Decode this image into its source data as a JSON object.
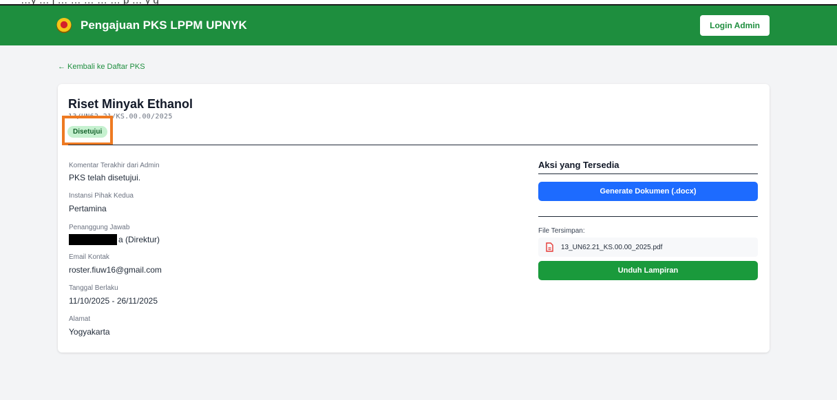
{
  "top_cut_text": "…y  …  j   …  …          …   …           …  p       …  y  g",
  "navbar": {
    "brand": "Pengajuan PKS LPPM UPNYK",
    "login_label": "Login Admin"
  },
  "back_link": "← Kembali ke Daftar PKS",
  "pks": {
    "title": "Riset Minyak Ethanol",
    "number": "13/UN62.21/KS.00.00/2025",
    "status": "Disetujui",
    "status_color": "#c6f1d0"
  },
  "fields": [
    {
      "label": "Komentar Terakhir dari Admin",
      "value": "PKS telah disetujui."
    },
    {
      "label": "Instansi Pihak Kedua",
      "value": "Pertamina"
    },
    {
      "label": "Penanggung Jawab",
      "value": "a (Direktur)"
    },
    {
      "label": "Email Kontak",
      "value": "roster.fiuw16@gmail.com"
    },
    {
      "label": "Tanggal Berlaku",
      "value": "11/10/2025 - 26/11/2025"
    },
    {
      "label": "Alamat",
      "value": "Yogyakarta"
    }
  ],
  "aksi": {
    "title": "Aksi yang Tersedia",
    "generate_label": "Generate Dokumen (.docx)",
    "files_label": "File Tersimpan:",
    "file_name": "13_UN62.21_KS.00.00_2025.pdf",
    "download_label": "Unduh Lampiran"
  },
  "colors": {
    "navbar": "#1e8e3e",
    "generate_button": "#1d6bff",
    "download_button": "#1a9a3c",
    "highlight_box": "#ee7a22"
  },
  "icons": {
    "logo": "university-logo-icon",
    "file": "pdf-file-icon"
  }
}
